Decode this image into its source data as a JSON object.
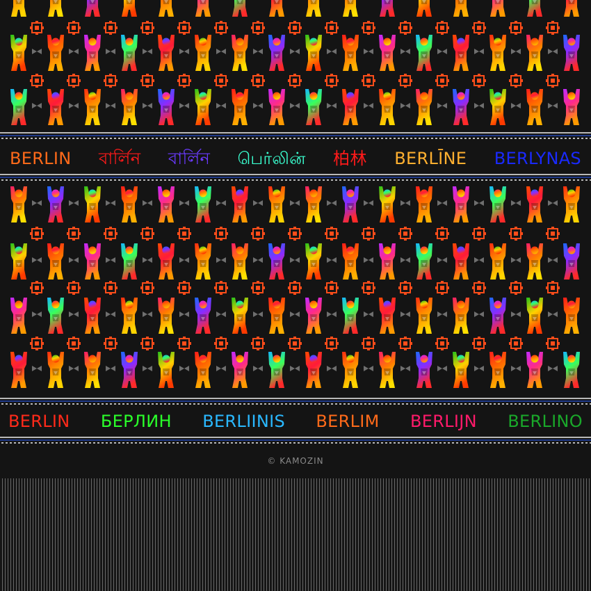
{
  "palette": {
    "background": "#141414",
    "border_blue": "#1f3a8a",
    "border_grey": "#b9b9b9",
    "bear_gradients": [
      [
        "#ff2a10",
        "#ff8a00",
        "#ffd400"
      ],
      [
        "#ff1a6a",
        "#ff7a00",
        "#ffe000"
      ],
      [
        "#1a6bff",
        "#8a2bff",
        "#ff2a2a"
      ],
      [
        "#22c21a",
        "#ffd000",
        "#ff3a00"
      ],
      [
        "#ff1a1a",
        "#ff6b00",
        "#ffb000"
      ],
      [
        "#c02aff",
        "#ff2a8a",
        "#ff9a00"
      ],
      [
        "#15b6ff",
        "#3aff5a",
        "#ff2a2a"
      ],
      [
        "#ff4a00",
        "#ff1a3a",
        "#ff9a00"
      ]
    ],
    "emblem": "#ff4d1a",
    "bowtie": "#6f6f6f"
  },
  "icons": {
    "bear": "buddy-bear-icon",
    "emblem": "emblem-icon",
    "bowtie": "bowtie-icon"
  },
  "band_top": [
    {
      "text": "BERLIN",
      "color": "#ff6a1a"
    },
    {
      "text": "বার্লিন",
      "color": "#ff1a1a"
    },
    {
      "text": "বার্লিন",
      "color": "#6a3aff"
    },
    {
      "text": "பெர்லின்",
      "color": "#3affd0"
    },
    {
      "text": "柏林",
      "color": "#ff1a1a"
    },
    {
      "text": "BERLĪNE",
      "color": "#ffb030"
    },
    {
      "text": "BERLYNAS",
      "color": "#1a2aff"
    }
  ],
  "band_bottom": [
    {
      "text": "BERLIN",
      "color": "#ff2a1a"
    },
    {
      "text": "БЕРЛИН",
      "color": "#2aff2a"
    },
    {
      "text": "BERLIINIS",
      "color": "#2ab8ff"
    },
    {
      "text": "BERLIM",
      "color": "#ff6a1a"
    },
    {
      "text": "BERLIJN",
      "color": "#ff1a6a"
    },
    {
      "text": "BERLINO",
      "color": "#1aa82a"
    }
  ],
  "copyright": "© KAMOZIN"
}
